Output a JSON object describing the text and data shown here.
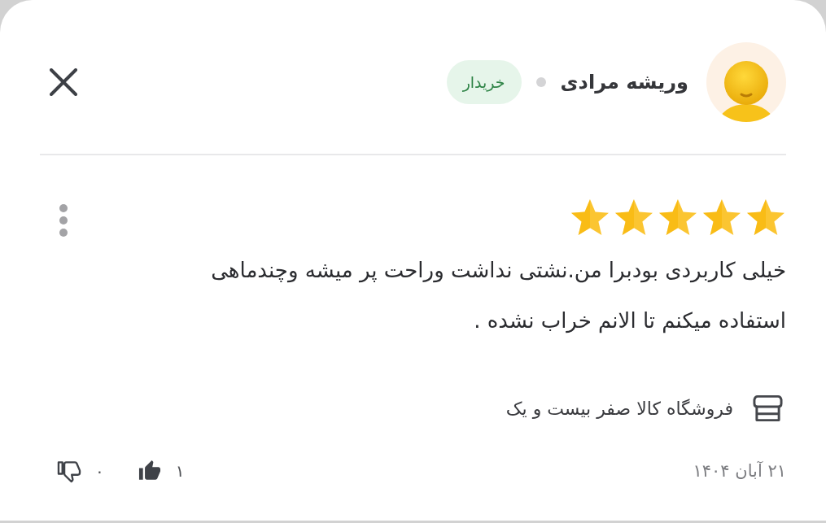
{
  "user": {
    "name": "وریشه مرادی",
    "badge": "خریدار"
  },
  "review": {
    "stars": 5,
    "text": "خیلی کاربردی بودبرا من.نشتی نداشت وراحت پر میشه وچندماهی استفاده میکنم تا الانم خراب نشده .",
    "seller": "فروشگاه کالا صفر بیست و یک",
    "date": "۲۱ آبان ۱۴۰۴"
  },
  "votes": [
    {
      "kind": "like",
      "count": "۱",
      "selected": true
    },
    {
      "kind": "dislike",
      "count": "۰",
      "selected": false
    }
  ]
}
